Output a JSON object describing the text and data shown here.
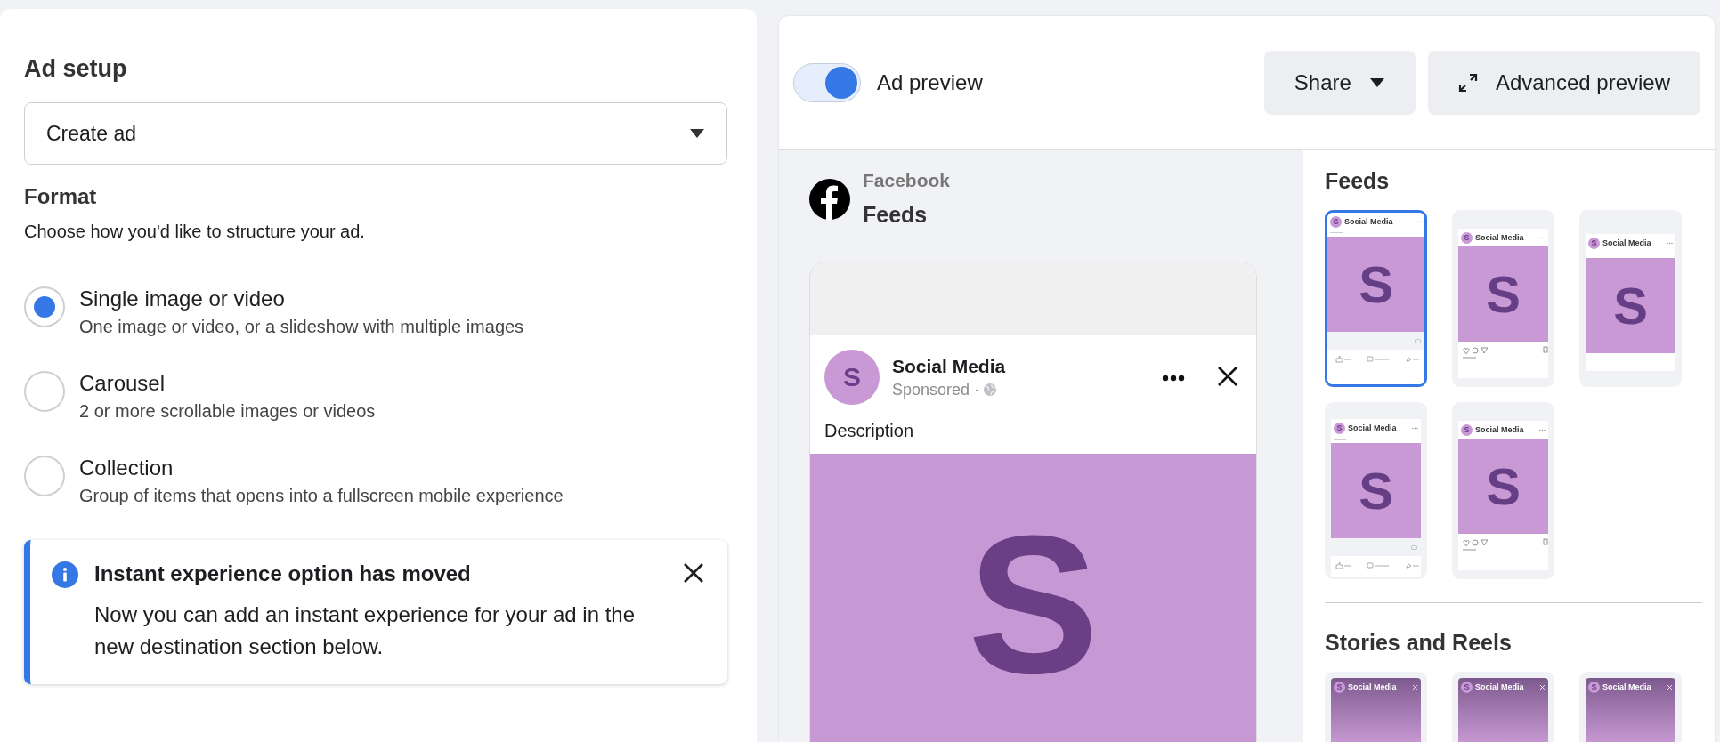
{
  "ad_setup": {
    "title": "Ad setup",
    "dropdown": {
      "value": "Create ad"
    },
    "format": {
      "title": "Format",
      "description": "Choose how you'd like to structure your ad.",
      "options": [
        {
          "label": "Single image or video",
          "description": "One image or video, or a slideshow with multiple images",
          "selected": true
        },
        {
          "label": "Carousel",
          "description": "2 or more scrollable images or videos",
          "selected": false
        },
        {
          "label": "Collection",
          "description": "Group of items that opens into a fullscreen mobile experience",
          "selected": false
        }
      ]
    },
    "notice": {
      "title": "Instant experience option has moved",
      "body": "Now you can add an instant experience for your ad in the new destination section below."
    }
  },
  "preview": {
    "toggle": {
      "label": "Ad preview",
      "on": true
    },
    "buttons": [
      {
        "label": "Share",
        "kind": "dropdown"
      },
      {
        "label": "Advanced preview",
        "kind": "expand"
      }
    ],
    "placement": {
      "platform": "Facebook",
      "name": "Feeds"
    },
    "post": {
      "page_name": "Social Media",
      "avatar_letter": "S",
      "meta": "Sponsored ·",
      "description": "Description",
      "image_letter": "S"
    },
    "sections": [
      {
        "title": "Feeds",
        "thumbnails": [
          {
            "kind": "facebook",
            "page_name": "Social Media",
            "avatar_letter": "S",
            "image_letter": "S",
            "selected": true
          },
          {
            "kind": "instagram",
            "page_name": "Social Media",
            "avatar_letter": "S",
            "image_letter": "S",
            "selected": false
          },
          {
            "kind": "plain",
            "page_name": "Social Media",
            "avatar_letter": "S",
            "image_letter": "S",
            "selected": false
          },
          {
            "kind": "facebook",
            "page_name": "Social Media",
            "avatar_letter": "S",
            "image_letter": "S",
            "selected": false
          },
          {
            "kind": "instagram",
            "page_name": "Social Media",
            "avatar_letter": "S",
            "image_letter": "S",
            "selected": false
          }
        ]
      },
      {
        "title": "Stories and Reels",
        "thumbnails": [
          {
            "kind": "story",
            "page_name": "Social Media",
            "avatar_letter": "S",
            "selected": false
          },
          {
            "kind": "story",
            "page_name": "Social Media",
            "avatar_letter": "S",
            "selected": false
          },
          {
            "kind": "story",
            "page_name": "Social Media",
            "avatar_letter": "S",
            "selected": false
          }
        ]
      }
    ]
  }
}
